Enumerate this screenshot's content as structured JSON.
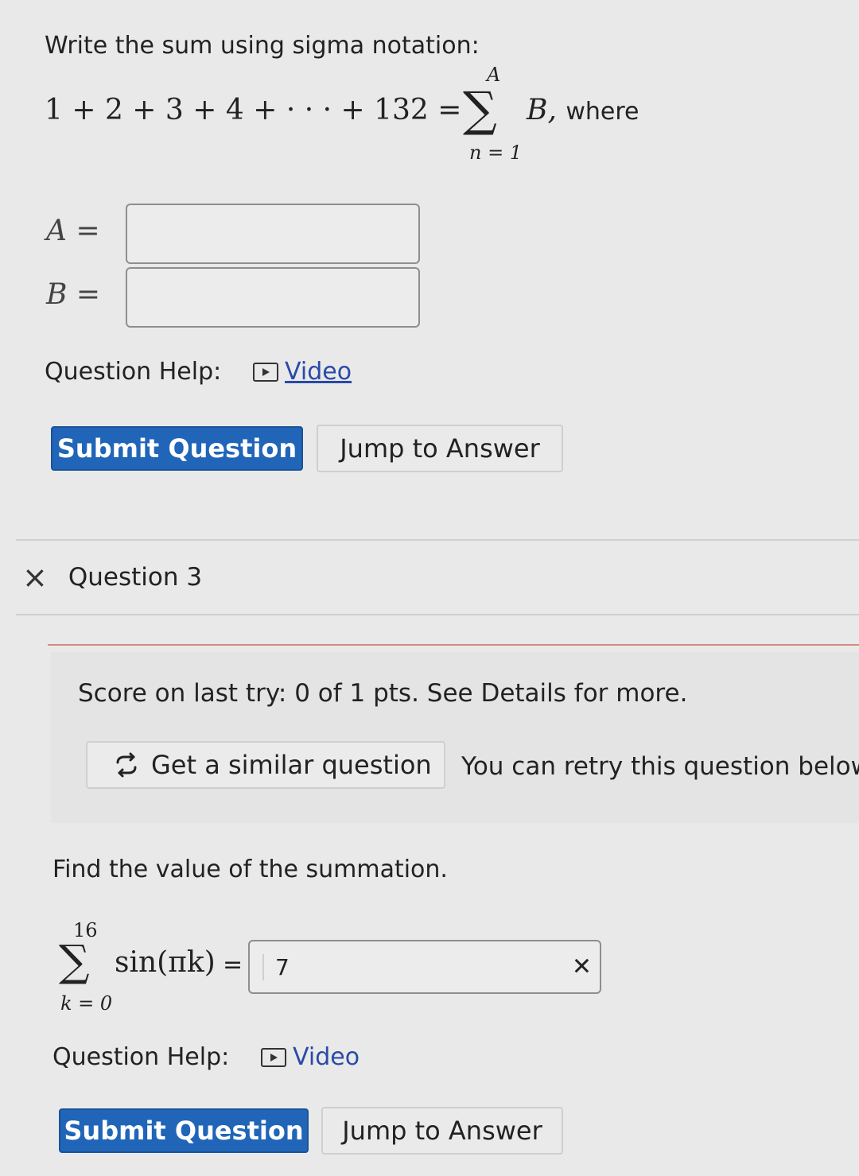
{
  "question2": {
    "prompt": "Write the sum using sigma notation:",
    "lhs": "1 + 2 + 3 + 4 + · · · + 132 =",
    "sigma_symbol": "∑",
    "sigma_upper": "A",
    "sigma_lower": "n = 1",
    "summand": "B,",
    "where": "where",
    "fields": [
      {
        "label": "A =",
        "value": ""
      },
      {
        "label": "B =",
        "value": ""
      }
    ],
    "help_label": "Question Help:",
    "video_label": "Video",
    "submit_label": "Submit Question",
    "jump_label": "Jump to Answer"
  },
  "question3": {
    "close_symbol": "×",
    "header": "Question 3",
    "score_text": "Score on last try: 0 of 1 pts. See Details for more.",
    "similar_label": "Get a similar question",
    "retry_text": "You can retry this question below",
    "find_text": "Find the value of the summation.",
    "sigma_symbol": "∑",
    "sigma_upper": "16",
    "sigma_lower": "k = 0",
    "expression": "sin(πk)",
    "equals": "=",
    "answer_value": "7",
    "answer_status": "incorrect",
    "wrong_mark": "✕",
    "help_label": "Question Help:",
    "video_label": "Video",
    "submit_label": "Submit Question",
    "jump_label": "Jump to Answer"
  },
  "colors": {
    "primary_button": "#2065b8",
    "link": "#2a4aa8",
    "divider_accent": "#d58a80"
  },
  "icons": [
    "play-icon",
    "close-icon",
    "retry-icon",
    "wrong-mark-icon"
  ]
}
